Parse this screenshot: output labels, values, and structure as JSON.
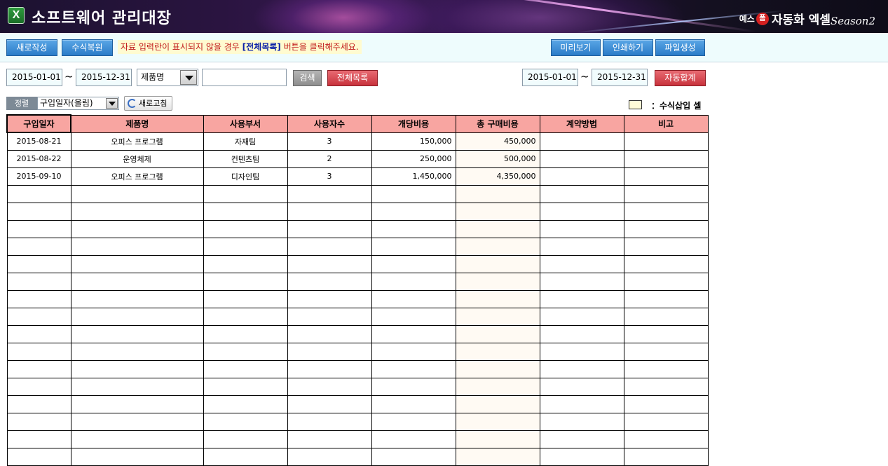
{
  "app": {
    "icon_text": "X",
    "title": "소프트웨어 관리대장",
    "brand": {
      "prefix": "예스",
      "badge": "폼",
      "name": "자동화 엑셀",
      "season": "Season2"
    }
  },
  "toolbar": {
    "new_label": "새로작성",
    "restore_label": "수식복원",
    "notice_before": "자료 입력란이 표시되지  않을 경우",
    "notice_highlight": "[전체목록]",
    "notice_after": "버튼을 클릭해주세요.",
    "preview_label": "미리보기",
    "print_label": "인쇄하기",
    "file_label": "파일생성"
  },
  "filter": {
    "date_from": "2015-01-01",
    "date_to": "2015-12-31",
    "tilde": "~",
    "field_select": "제품명",
    "keyword": "",
    "search_label": "검색",
    "all_label": "전체목록",
    "sum_date_from": "2015-01-01",
    "sum_date_to": "2015-12-31",
    "autosum_label": "자동합계"
  },
  "sort": {
    "label": "정렬",
    "value": "구입일자(올림)",
    "refresh_label": "새로고침"
  },
  "legend": {
    "text": "：수식삽입 셀"
  },
  "table": {
    "columns": [
      "구입일자",
      "제품명",
      "사용부서",
      "사용자수",
      "개당비용",
      "총 구매비용",
      "계약방법",
      "비고"
    ],
    "rows": [
      [
        "2015-08-21",
        "오피스 프로그램",
        "자재팀",
        "3",
        "150,000",
        "450,000",
        "",
        ""
      ],
      [
        "2015-08-22",
        "운영체제",
        "컨텐츠팀",
        "2",
        "250,000",
        "500,000",
        "",
        ""
      ],
      [
        "2015-09-10",
        "오피스 프로그램",
        "디자인팀",
        "3",
        "1,450,000",
        "4,350,000",
        "",
        ""
      ]
    ],
    "empty_rows": 16
  }
}
